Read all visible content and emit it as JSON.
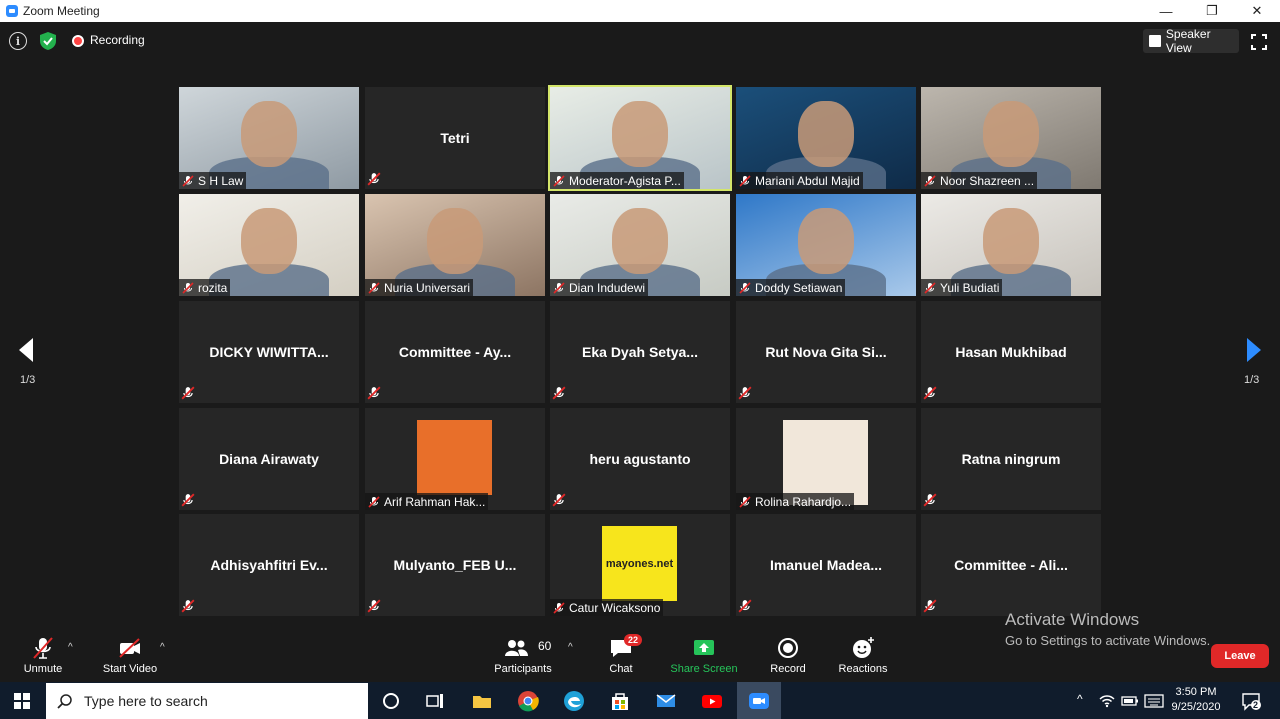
{
  "window": {
    "title": "Zoom Meeting",
    "minimize_glyph": "—",
    "maximize_glyph": "❐",
    "close_glyph": "✕"
  },
  "topbar": {
    "recording_label": "Recording",
    "speaker_view_label": "Speaker View",
    "info_glyph": "i"
  },
  "pager": {
    "left_page": "1/3",
    "right_page": "1/3"
  },
  "tiles": [
    {
      "name": "S H Law",
      "video": true
    },
    {
      "name": "Tetri",
      "video": false
    },
    {
      "name": "Moderator-Agista P...",
      "video": true,
      "active": true
    },
    {
      "name": "Mariani Abdul Majid",
      "video": true
    },
    {
      "name": "Noor Shazreen ...",
      "video": true
    },
    {
      "name": "rozita",
      "video": true
    },
    {
      "name": "Nuria Universari",
      "video": true
    },
    {
      "name": "Dian Indudewi",
      "video": true
    },
    {
      "name": "Doddy Setiawan",
      "video": true
    },
    {
      "name": "Yuli Budiati",
      "video": true
    },
    {
      "name": "DICKY WIWITTA...",
      "video": false
    },
    {
      "name": "Committee - Ay...",
      "video": false
    },
    {
      "name": "Eka Dyah Setya...",
      "video": false
    },
    {
      "name": "Rut Nova Gita Si...",
      "video": false
    },
    {
      "name": "Hasan Mukhibad",
      "video": false
    },
    {
      "name": "Diana Airawaty",
      "video": false
    },
    {
      "name": "Arif Rahman Hak...",
      "video": false,
      "avatar": true
    },
    {
      "name": "heru agustanto",
      "video": false
    },
    {
      "name": "Rolina Rahardjo...",
      "video": false,
      "avatar": true
    },
    {
      "name": "Ratna ningrum",
      "video": false
    },
    {
      "name": "Adhisyahfitri Ev...",
      "video": false
    },
    {
      "name": "Mulyanto_FEB U...",
      "video": false
    },
    {
      "name": "Catur Wicaksono",
      "video": false,
      "avatar": true,
      "avatar_text": "mayones.net"
    },
    {
      "name": "Imanuel Madea...",
      "video": false
    },
    {
      "name": "Committee - Ali...",
      "video": false
    }
  ],
  "controls": {
    "unmute_label": "Unmute",
    "start_video_label": "Start Video",
    "participants_label": "Participants",
    "participants_count": "60",
    "chat_label": "Chat",
    "chat_badge": "22",
    "share_label": "Share Screen",
    "record_label": "Record",
    "reactions_label": "Reactions",
    "leave_label": "Leave",
    "caret_glyph": "^"
  },
  "watermark": {
    "line1": "Activate Windows",
    "line2": "Go to Settings to activate Windows."
  },
  "taskbar": {
    "search_placeholder": "Type here to search",
    "time": "3:50 PM",
    "date": "9/25/2020",
    "notification_count": "2"
  },
  "colors": {
    "accent_blue": "#2d8cff",
    "leave_red": "#e02828",
    "share_green": "#26c45a",
    "active_speaker": "#d4e66a"
  }
}
